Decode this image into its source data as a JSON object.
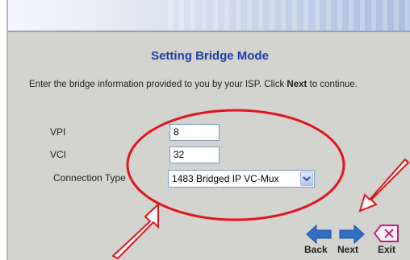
{
  "title": "Setting Bridge Mode",
  "instructions": {
    "before": "Enter the bridge information provided to you by your ISP. Click ",
    "emphasis": "Next",
    "after": " to continue."
  },
  "form": {
    "vpi": {
      "label": "VPI",
      "value": "8"
    },
    "vci": {
      "label": "VCI",
      "value": "32"
    },
    "connection_type": {
      "label": "Connection Type",
      "value": "1483 Bridged IP VC-Mux"
    }
  },
  "nav": {
    "back_label": "Back",
    "next_label": "Next",
    "exit_label": "Exit"
  },
  "colors": {
    "title": "#1f3ea6",
    "annotation": "#e0151e",
    "nav_arrow": "#2f6fc4",
    "exit_icon": "#c0237f"
  },
  "icons": [
    "back-arrow-icon",
    "next-arrow-icon",
    "exit-icon",
    "chevron-down-icon"
  ]
}
